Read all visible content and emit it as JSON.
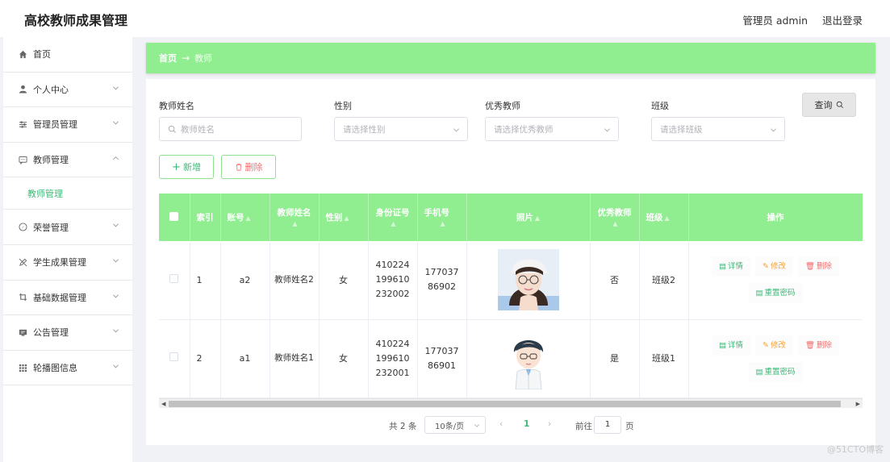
{
  "header": {
    "app_title": "高校教师成果管理",
    "admin_label": "管理员 admin",
    "logout_label": "退出登录"
  },
  "sidebar": {
    "items": [
      {
        "label": "首页",
        "icon": "home-icon"
      },
      {
        "label": "个人中心",
        "icon": "user-icon"
      },
      {
        "label": "管理员管理",
        "icon": "sliders-icon"
      },
      {
        "label": "教师管理",
        "icon": "chat-icon",
        "expanded": true
      },
      {
        "label": "荣誉管理",
        "icon": "compass-icon"
      },
      {
        "label": "学生成果管理",
        "icon": "pen-off-icon"
      },
      {
        "label": "基础数据管理",
        "icon": "crop-icon"
      },
      {
        "label": "公告管理",
        "icon": "card-icon"
      },
      {
        "label": "轮播图信息",
        "icon": "grid-icon"
      }
    ],
    "sub_item": "教师管理"
  },
  "breadcrumb": {
    "home": "首页",
    "current": "教师"
  },
  "filters": {
    "name_label": "教师姓名",
    "name_placeholder": "教师姓名",
    "gender_label": "性别",
    "gender_placeholder": "请选择性别",
    "excellent_label": "优秀教师",
    "excellent_placeholder": "请选择优秀教师",
    "class_label": "班级",
    "class_placeholder": "请选择班级",
    "query_label": "查询"
  },
  "actions": {
    "add_label": "新增",
    "delete_label": "删除"
  },
  "table": {
    "headers": {
      "index": "索引",
      "account": "账号",
      "name": "教师姓名",
      "gender": "性别",
      "id_card": "身份证号",
      "phone": "手机号",
      "photo": "照片",
      "excellent": "优秀教师",
      "class": "班级",
      "ops": "操作"
    },
    "rows": [
      {
        "index": "1",
        "account": "a2",
        "name": "教师姓名2",
        "gender": "女",
        "id_card": "410224199610232002",
        "phone": "17703786902",
        "photo": "female-teacher-photo",
        "excellent": "否",
        "class": "班级2"
      },
      {
        "index": "2",
        "account": "a1",
        "name": "教师姓名1",
        "gender": "女",
        "id_card": "410224199610232001",
        "phone": "17703786901",
        "photo": "cartoon-teacher-photo",
        "excellent": "是",
        "class": "班级1"
      }
    ],
    "op_labels": {
      "detail": "详情",
      "edit": "修改",
      "delete": "删除",
      "reset": "重置密码"
    }
  },
  "pagination": {
    "total": "共 2 条",
    "page_size": "10条/页",
    "current_page": "1",
    "goto_label": "前往",
    "goto_value": "1",
    "page_unit": "页"
  },
  "watermark": "@51CTO博客",
  "colors": {
    "accent": "#90ed90",
    "primary_text": "#3cb878",
    "danger": "#f56c6c",
    "warning": "#f3a43d"
  }
}
